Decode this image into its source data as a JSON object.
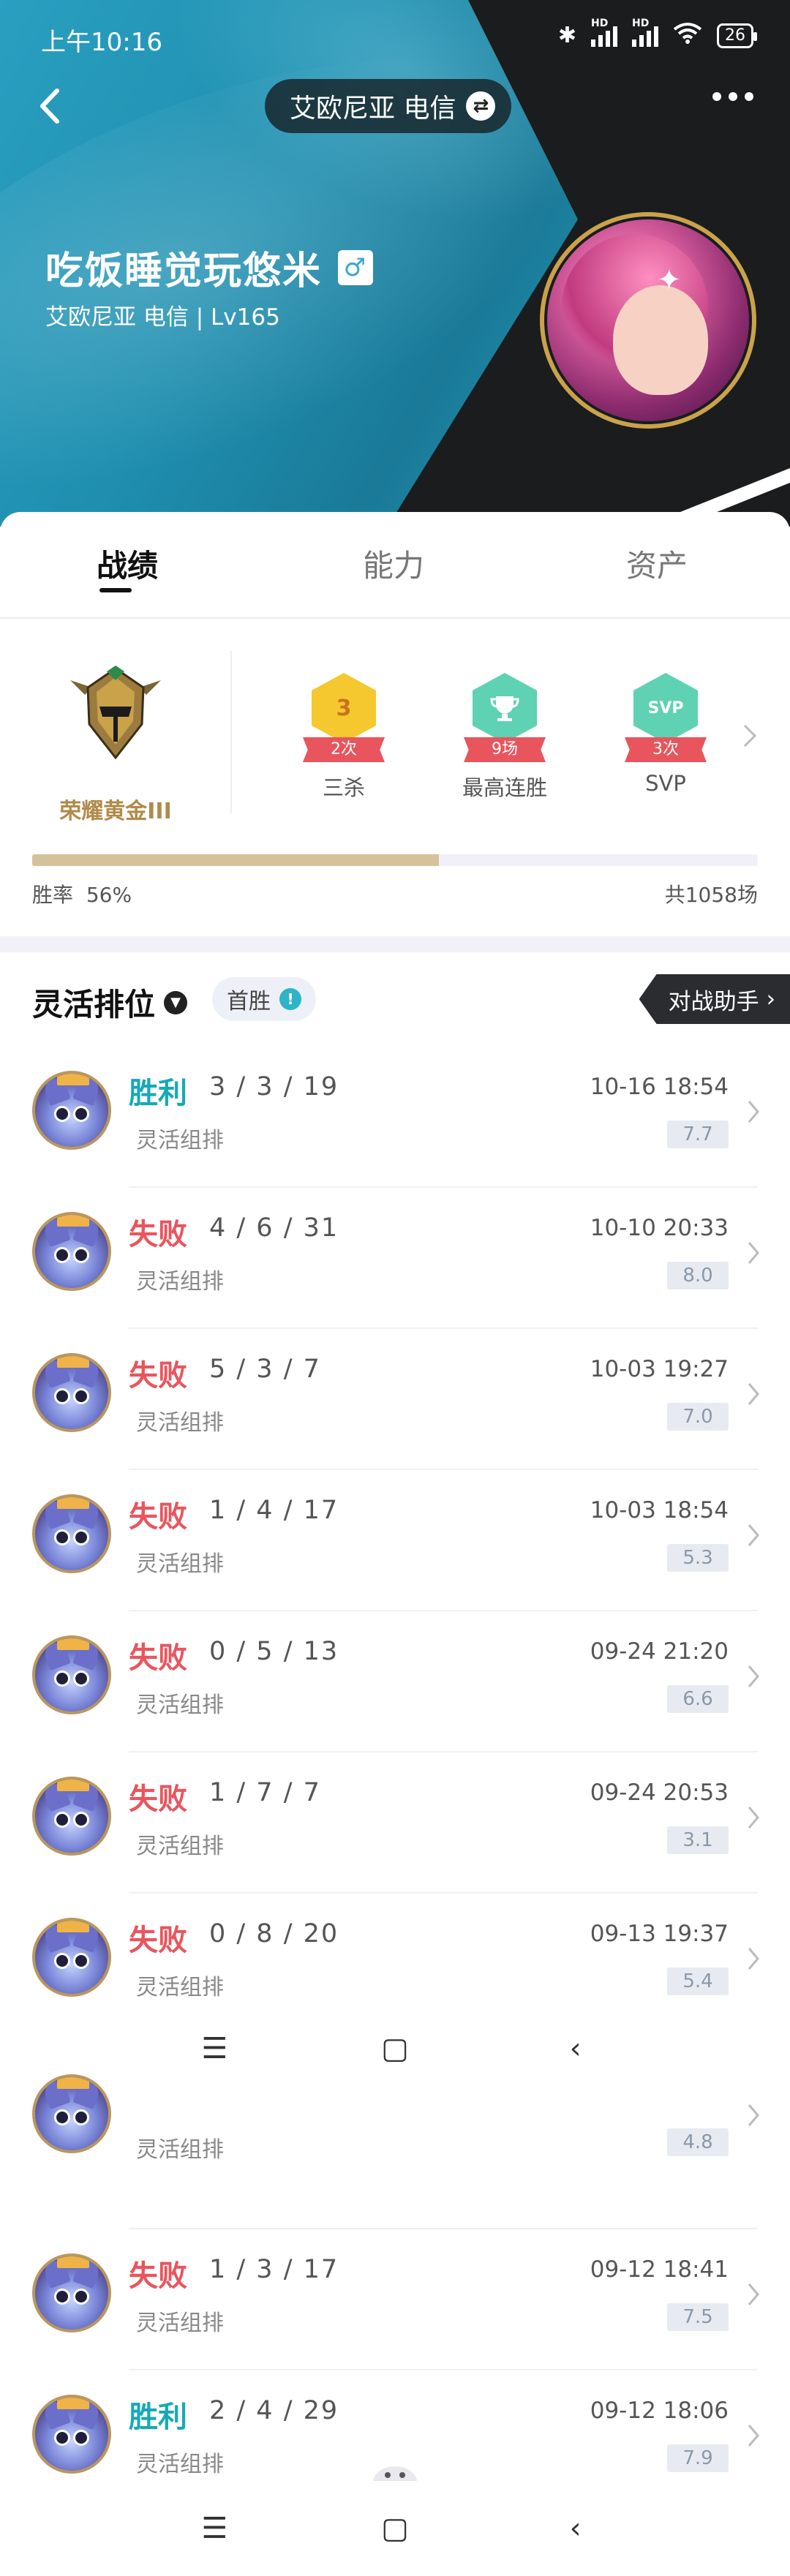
{
  "status_bar": {
    "time": "上午10:16",
    "battery": "26",
    "hd1": "HD",
    "hd2": "HD"
  },
  "header": {
    "server": "艾欧尼亚 电信",
    "player_name": "吃饭睡觉玩悠米",
    "gender_icon": "male-icon",
    "server_level": "艾欧尼亚 电信 | Lv165"
  },
  "tabs": [
    {
      "label": "战绩",
      "active": true
    },
    {
      "label": "能力",
      "active": false
    },
    {
      "label": "资产",
      "active": false
    }
  ],
  "summary": {
    "rank": "荣耀黄金III",
    "badges": [
      {
        "icon": "3",
        "count": "2次",
        "label": "三杀",
        "color": "#f5c82f"
      },
      {
        "icon": "trophy-icon",
        "count": "9场",
        "label": "最高连胜",
        "color": "#5ed2b2"
      },
      {
        "icon": "SVP",
        "count": "3次",
        "label": "SVP",
        "color": "#5ed2b2"
      }
    ],
    "win_rate_label": "胜率",
    "win_rate": "56%",
    "win_rate_value": 0.56,
    "total_games": "共1058场"
  },
  "queue": {
    "title": "灵活排位",
    "first_win": "首胜",
    "assistant": "对战助手"
  },
  "matches": [
    {
      "result": "胜利",
      "outcome": "win",
      "kda": "3 / 3 / 19",
      "mode": "灵活组排",
      "time": "10-16 18:54",
      "score": "7.7"
    },
    {
      "result": "失败",
      "outcome": "loss",
      "kda": "4 / 6 / 31",
      "mode": "灵活组排",
      "time": "10-10 20:33",
      "score": "8.0"
    },
    {
      "result": "失败",
      "outcome": "loss",
      "kda": "5 / 3 / 7",
      "mode": "灵活组排",
      "time": "10-03 19:27",
      "score": "7.0"
    },
    {
      "result": "失败",
      "outcome": "loss",
      "kda": "1 / 4 / 17",
      "mode": "灵活组排",
      "time": "10-03 18:54",
      "score": "5.3"
    },
    {
      "result": "失败",
      "outcome": "loss",
      "kda": "0 / 5 / 13",
      "mode": "灵活组排",
      "time": "09-24 21:20",
      "score": "6.6"
    },
    {
      "result": "失败",
      "outcome": "loss",
      "kda": "1 / 7 / 7",
      "mode": "灵活组排",
      "time": "09-24 20:53",
      "score": "3.1"
    },
    {
      "result": "失败",
      "outcome": "loss",
      "kda": "0 / 8 / 20",
      "mode": "灵活组排",
      "time": "09-13 19:37",
      "score": "5.4"
    }
  ],
  "matches_lower": [
    {
      "mode": "灵活组排",
      "score": "4.8"
    },
    {
      "result": "失败",
      "outcome": "loss",
      "kda": "1 / 3 / 17",
      "mode": "灵活组排",
      "time": "09-12 18:41",
      "score": "7.5"
    },
    {
      "result": "胜利",
      "outcome": "win",
      "kda": "2 / 4 / 29",
      "mode": "灵活组排",
      "time": "09-12 18:06",
      "score": "7.9"
    }
  ],
  "system_nav": {
    "menu": "☰",
    "home": "▢",
    "back": "‹"
  }
}
